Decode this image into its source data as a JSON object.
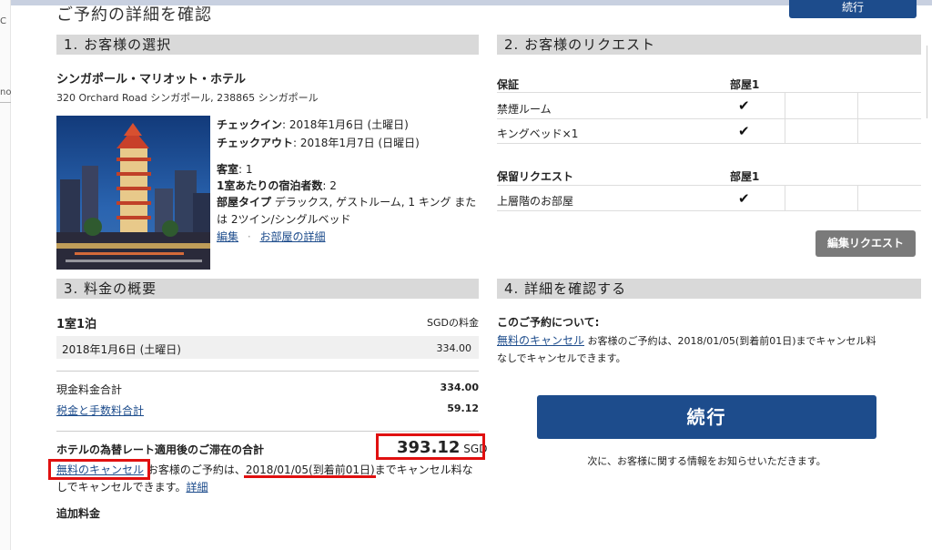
{
  "page_title": "ご予約の詳細を確認",
  "top_button": "続行",
  "left_pane": {
    "t1": "C",
    "t2": "no"
  },
  "sections": {
    "s1": "1. お客様の選択",
    "s2": "2. お客様のリクエスト",
    "s3": "3. 料金の概要",
    "s4": "4. 詳細を確認する"
  },
  "hotel": {
    "name": "シンガポール・マリオット・ホテル",
    "address": "320 Orchard Road シンガポール, 238865 シンガポール",
    "checkin_label": "チェックイン",
    "checkin_value": ": 2018年1月6日 (土曜日)",
    "checkout_label": "チェックアウト",
    "checkout_value": ": 2018年1月7日 (日曜日)",
    "rooms_label": "客室",
    "rooms_value": ": 1",
    "guests_label": "1室あたりの宿泊者数",
    "guests_value": ": 2",
    "roomtype_label": "部屋タイプ",
    "roomtype_value1": " デラックス, ゲストルーム, 1 キング また",
    "roomtype_value2": "は 2ツイン/シングルベッド",
    "edit_link": "編集",
    "room_details_link": "お部屋の詳細"
  },
  "requests": {
    "guarantee_label": "保証",
    "room1": "部屋1",
    "nonsmoking": "禁煙ルーム",
    "king_bed": "キングベッド×1",
    "hold_label": "保留リクエスト",
    "room1_b": "部屋1",
    "upper_floor": "上層階のお部屋",
    "check": "✔",
    "edit_button": "編集リクエスト"
  },
  "pricing": {
    "nights": "1室1泊",
    "currency_label": "SGDの料金",
    "date_row": "2018年1月6日 (土曜日)",
    "date_amount": "334.00",
    "cash_total_label": "現金料金合計",
    "cash_total": "334.00",
    "taxes_label": "税金と手数料合計",
    "taxes": "59.12",
    "stay_total_label": "ホテルの為替レート適用後のご滞在の合計",
    "stay_total": "393.12",
    "stay_currency": "SGD",
    "free_cancel": "無料のキャンセル",
    "cancel_text1": " お客様のご予約は",
    "cancel_date": "、2018/01/05(到着前01日)",
    "cancel_text2": "までキャンセル料な",
    "cancel_text3": "しでキャンセルできます。",
    "details_link": "詳細",
    "additional": "追加料金"
  },
  "confirm": {
    "about_label": "このご予約について:",
    "free_cancel": "無料のキャンセル",
    "text1": " お客様のご予約は、2018/01/05(到着前01日)までキャンセル料",
    "text2": "なしでキャンセルできます。",
    "continue_button": "続行",
    "next_note": "次に、お客様に関する情報をお知らせいただきます。"
  },
  "colors": {
    "accent": "#1d4c8c",
    "section_bg": "#d9d9d9",
    "highlight": "#e01010"
  }
}
